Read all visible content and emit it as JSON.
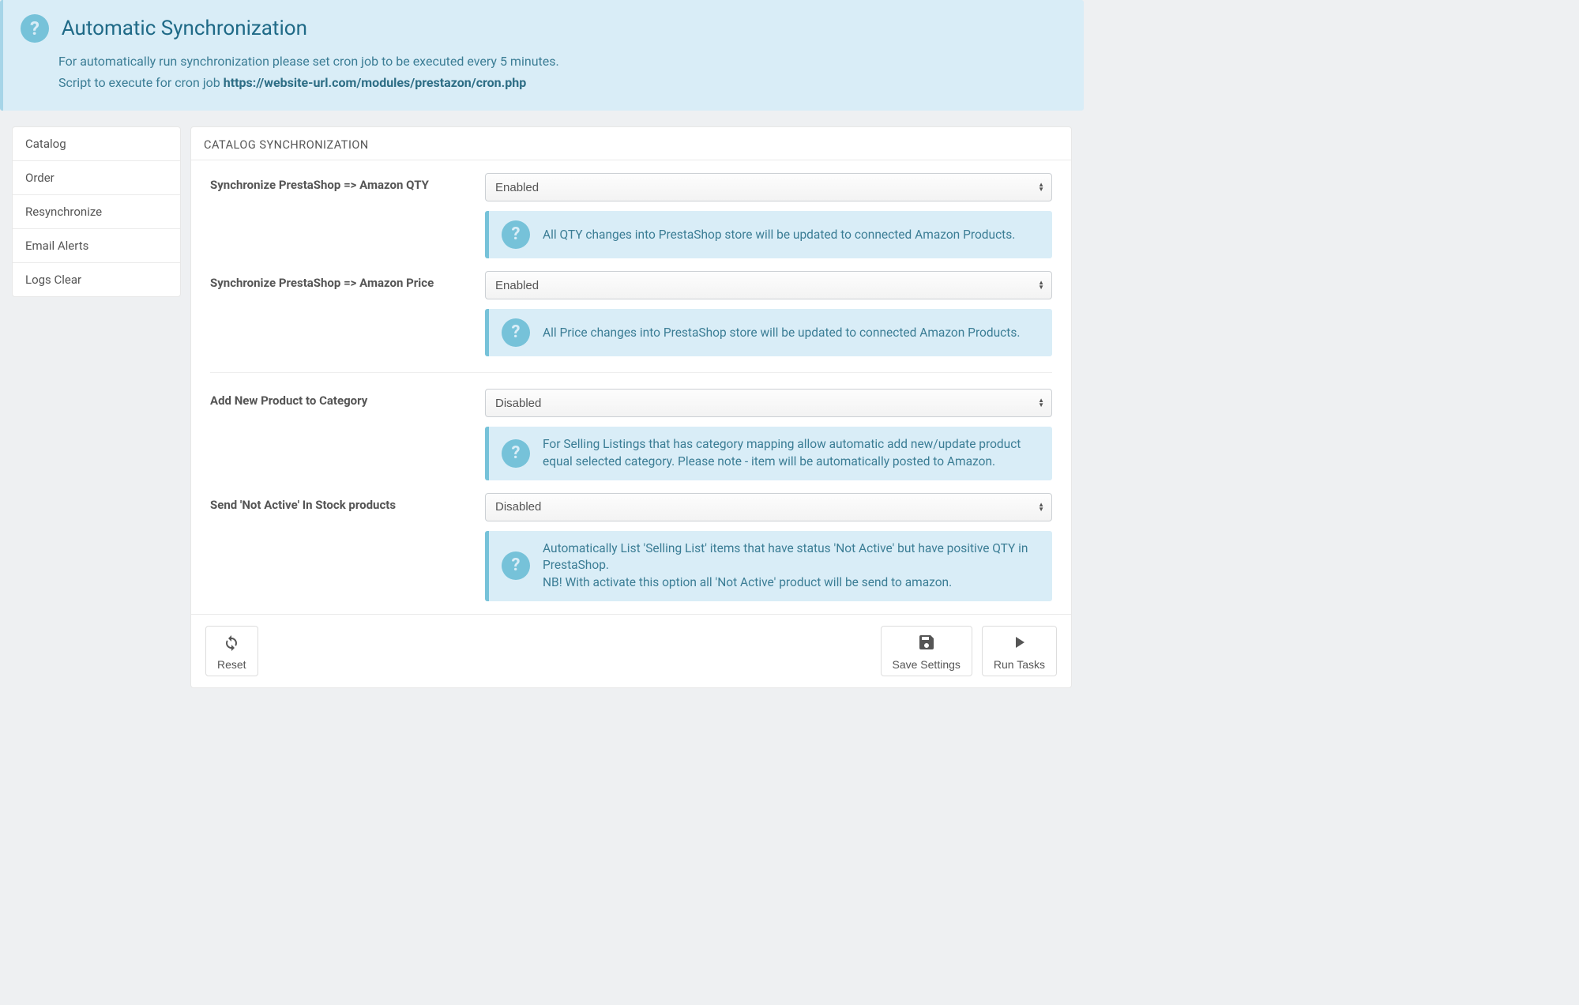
{
  "alert": {
    "title": "Automatic Synchronization",
    "line1": "For automatically run synchronization please set cron job to be executed every 5 minutes.",
    "line2_prefix": "Script to execute for cron job ",
    "line2_url": "https://website-url.com/modules/prestazon/cron.php"
  },
  "sidebar": {
    "items": [
      "Catalog",
      "Order",
      "Resynchronize",
      "Email Alerts",
      "Logs Clear"
    ]
  },
  "panel": {
    "heading": "CATALOG SYNCHRONIZATION",
    "rows": [
      {
        "label": "Synchronize PrestaShop => Amazon QTY",
        "value": "Enabled",
        "hint": "All QTY changes into PrestaShop store will be updated to connected Amazon Products."
      },
      {
        "label": "Synchronize PrestaShop => Amazon Price",
        "value": "Enabled",
        "hint": "All Price changes into PrestaShop store will be updated to connected Amazon Products."
      },
      {
        "label": "Add New Product to Category",
        "value": "Disabled",
        "hint": "For Selling Listings that has category mapping allow automatic add new/update product equal selected category. Please note - item will be automatically posted to Amazon."
      },
      {
        "label": "Send 'Not Active' In Stock products",
        "value": "Disabled",
        "hint": "Automatically List 'Selling List' items that have status 'Not Active' but have positive QTY in PrestaShop.\nNB! With activate this option all 'Not Active' product will be send to amazon."
      }
    ]
  },
  "footer": {
    "reset": "Reset",
    "save": "Save Settings",
    "run": "Run Tasks"
  }
}
